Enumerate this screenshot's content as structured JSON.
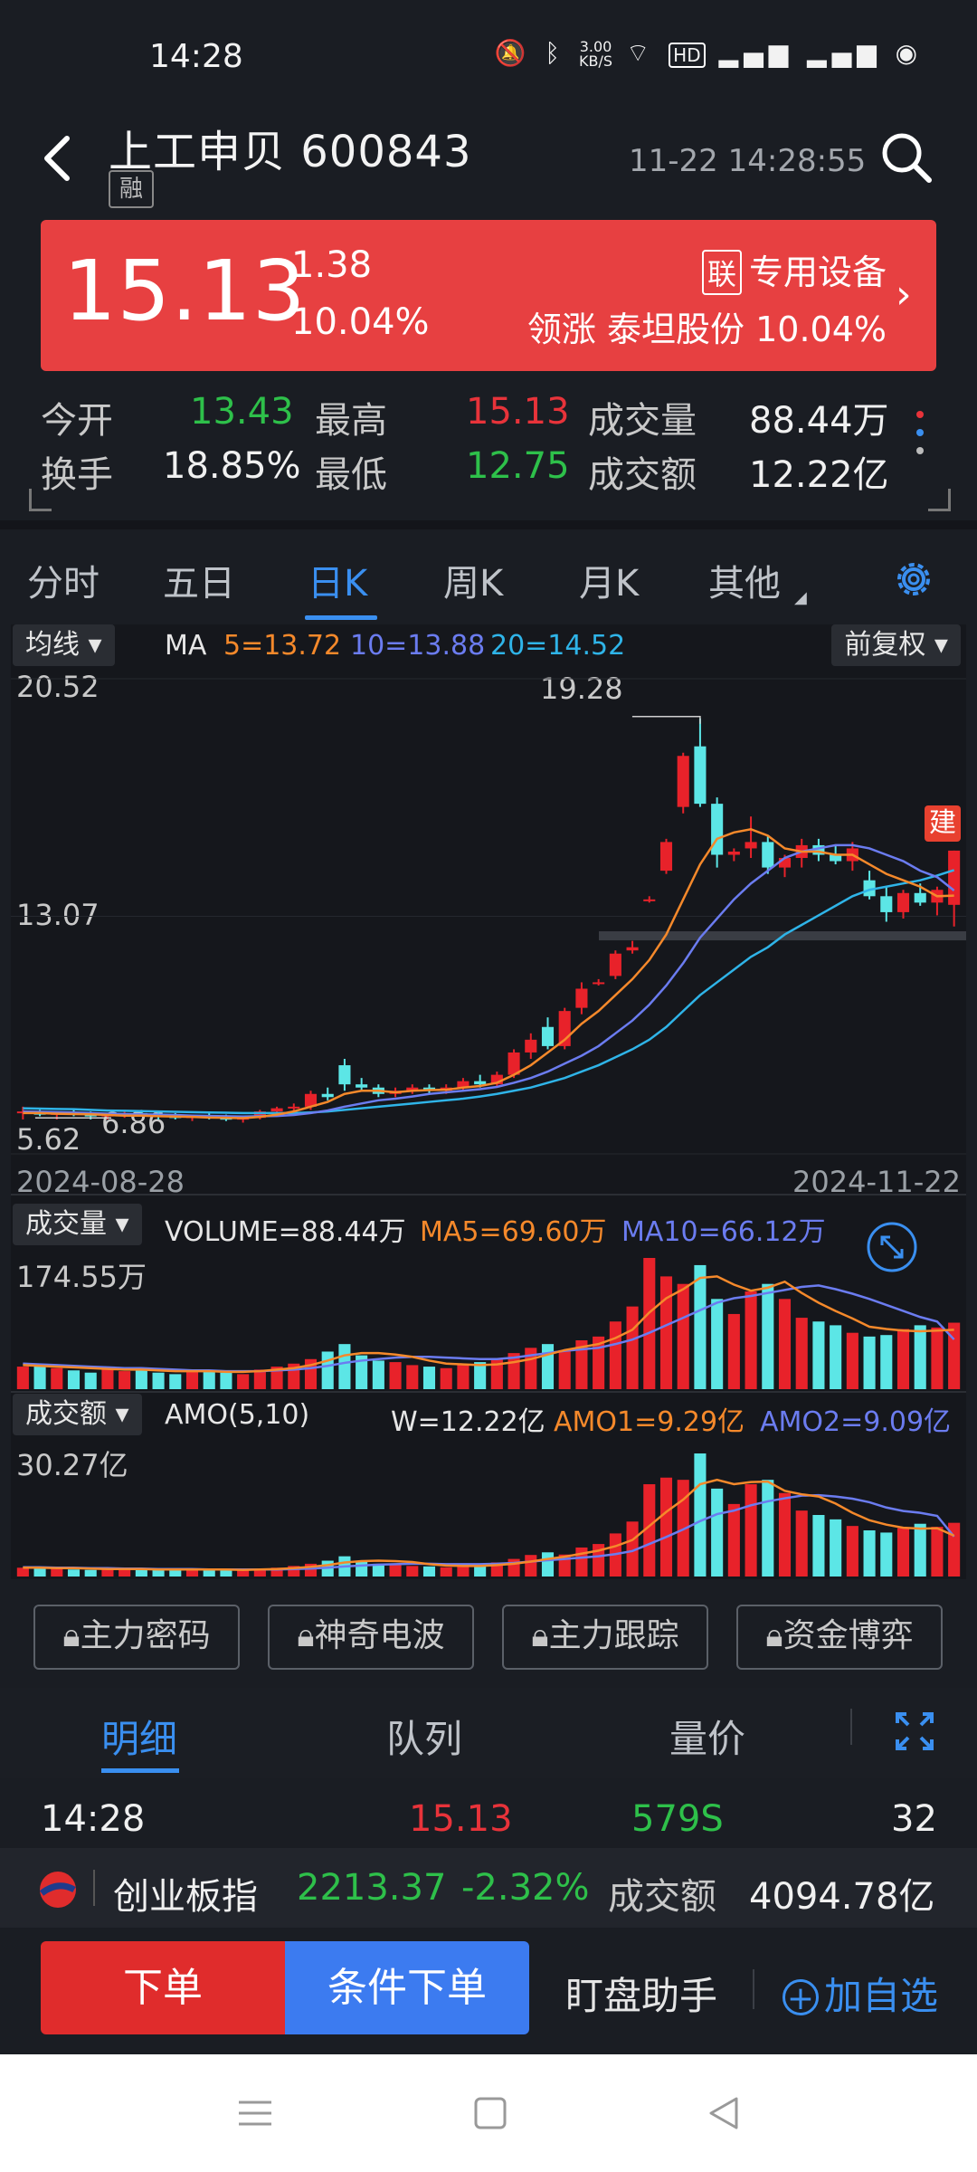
{
  "status": {
    "time": "14:28",
    "net_speed_top": "3.00",
    "net_speed_unit": "KB/S"
  },
  "header": {
    "back_icon": "chevron-left-icon",
    "title": "上工申贝 600843",
    "badge": "融",
    "datetime": "11-22 14:28:55"
  },
  "quote": {
    "price": "15.13",
    "change": "1.38",
    "change_pct": "10.04%",
    "sector_tag": "联",
    "sector": "专用设备",
    "leader_prefix": "领涨",
    "leader_name": "泰坦股份",
    "leader_pct": "10.04%"
  },
  "stats": {
    "open_label": "今开",
    "open": "13.43",
    "high_label": "最高",
    "high": "15.13",
    "volume_label": "成交量",
    "volume": "88.44万",
    "turnover_label": "换手",
    "turnover": "18.85%",
    "low_label": "最低",
    "low": "12.75",
    "amount_label": "成交额",
    "amount": "12.22亿"
  },
  "tabs": [
    "分时",
    "五日",
    "日K",
    "周K",
    "月K",
    "其他"
  ],
  "active_tab": "日K",
  "kline": {
    "indicator_pill": "均线",
    "ma_label": "MA",
    "ma5": "5=13.72",
    "ma10": "10=13.88",
    "ma20": "20=14.52",
    "adjust_pill": "前复权",
    "y_top": "20.52",
    "y_mid": "13.07",
    "y_bottom": "5.62",
    "high_mark": "19.28",
    "low_mark": "6.86",
    "date_start": "2024-08-28",
    "date_end": "2024-11-22",
    "jian": "建",
    "colors": {
      "ma5": "#f5892b",
      "ma10": "#6b7cf0",
      "ma20": "#2fb4e8",
      "up": "#e8222a",
      "down": "#5ce6e6"
    }
  },
  "volume": {
    "pill": "成交量",
    "label": "VOLUME=88.44万",
    "ma5": "MA5=69.60万",
    "ma10": "MA10=66.12万",
    "ymax": "174.55万"
  },
  "amount": {
    "pill": "成交额",
    "label": "AMO(5,10)",
    "label_w": "W=12.22亿",
    "amo1": "AMO1=9.29亿",
    "amo2": "AMO2=9.09亿",
    "ymax": "30.27亿"
  },
  "feature_buttons": [
    "主力密码",
    "神奇电波",
    "主力跟踪",
    "资金博弈"
  ],
  "detail_tabs": [
    "明细",
    "队列",
    "量价"
  ],
  "trade_row": {
    "time": "14:28",
    "price": "15.13",
    "vol": "579S",
    "count": "32"
  },
  "index_bar": {
    "name": "创业板指",
    "value": "2213.37",
    "pct": "-2.32%",
    "amount_label": "成交额",
    "amount": "4094.78亿"
  },
  "bottom": {
    "order": "下单",
    "cond_order": "条件下单",
    "assistant": "盯盘助手",
    "add_fav": "加自选"
  },
  "chart_data": {
    "type": "candlestick",
    "x": [
      "2024-08-28",
      "2024-11-22"
    ],
    "ylim": [
      5.62,
      20.52
    ],
    "annotations": {
      "max": 19.28,
      "min": 6.86
    },
    "ohlc": [
      [
        6.9,
        7.1,
        6.7,
        6.95
      ],
      [
        6.95,
        7.0,
        6.8,
        6.85
      ],
      [
        6.85,
        6.95,
        6.7,
        6.9
      ],
      [
        6.9,
        7.0,
        6.8,
        6.85
      ],
      [
        6.85,
        6.95,
        6.7,
        6.8
      ],
      [
        6.8,
        6.9,
        6.7,
        6.85
      ],
      [
        6.85,
        6.95,
        6.75,
        6.9
      ],
      [
        6.9,
        7.0,
        6.8,
        6.85
      ],
      [
        6.85,
        6.95,
        6.7,
        6.8
      ],
      [
        6.8,
        6.9,
        6.7,
        6.75
      ],
      [
        6.75,
        6.85,
        6.65,
        6.8
      ],
      [
        6.8,
        6.9,
        6.7,
        6.75
      ],
      [
        6.75,
        6.85,
        6.65,
        6.7
      ],
      [
        6.7,
        6.8,
        6.6,
        6.75
      ],
      [
        6.75,
        7.0,
        6.7,
        6.95
      ],
      [
        6.95,
        7.1,
        6.85,
        7.05
      ],
      [
        7.05,
        7.2,
        6.95,
        7.1
      ],
      [
        7.1,
        7.6,
        7.0,
        7.5
      ],
      [
        7.5,
        7.7,
        7.3,
        7.4
      ],
      [
        8.4,
        8.6,
        7.6,
        7.8
      ],
      [
        7.8,
        8.0,
        7.6,
        7.7
      ],
      [
        7.7,
        7.8,
        7.4,
        7.5
      ],
      [
        7.5,
        7.7,
        7.4,
        7.6
      ],
      [
        7.6,
        7.8,
        7.5,
        7.7
      ],
      [
        7.7,
        7.8,
        7.5,
        7.6
      ],
      [
        7.6,
        7.8,
        7.5,
        7.7
      ],
      [
        7.7,
        8.0,
        7.6,
        7.9
      ],
      [
        7.9,
        8.1,
        7.7,
        7.8
      ],
      [
        7.8,
        8.2,
        7.7,
        8.1
      ],
      [
        8.1,
        8.9,
        8.0,
        8.8
      ],
      [
        8.8,
        9.4,
        8.6,
        9.2
      ],
      [
        9.6,
        9.9,
        8.9,
        9.0
      ],
      [
        9.0,
        10.2,
        8.9,
        10.1
      ],
      [
        10.2,
        11.0,
        10.0,
        10.8
      ],
      [
        11.0,
        11.1,
        10.9,
        11.0
      ],
      [
        11.2,
        12.0,
        11.1,
        11.9
      ],
      [
        12.0,
        12.3,
        11.9,
        12.1
      ],
      [
        13.6,
        13.7,
        13.5,
        13.6
      ],
      [
        14.5,
        15.5,
        14.4,
        15.4
      ],
      [
        16.5,
        18.2,
        16.3,
        18.1
      ],
      [
        18.4,
        19.28,
        16.5,
        16.6
      ],
      [
        16.6,
        16.8,
        14.6,
        15.0
      ],
      [
        15.0,
        15.2,
        14.8,
        15.1
      ],
      [
        15.2,
        16.2,
        14.9,
        15.4
      ],
      [
        15.4,
        15.6,
        14.4,
        14.6
      ],
      [
        14.6,
        15.0,
        14.3,
        14.9
      ],
      [
        14.9,
        15.5,
        14.6,
        15.3
      ],
      [
        15.3,
        15.5,
        14.8,
        15.0
      ],
      [
        15.0,
        15.3,
        14.7,
        14.8
      ],
      [
        14.8,
        15.4,
        14.5,
        15.2
      ],
      [
        14.2,
        14.5,
        13.6,
        13.7
      ],
      [
        13.7,
        14.0,
        12.9,
        13.2
      ],
      [
        13.2,
        13.9,
        13.0,
        13.8
      ],
      [
        13.8,
        14.1,
        13.4,
        13.5
      ],
      [
        13.5,
        14.0,
        13.1,
        13.9
      ],
      [
        13.43,
        15.13,
        12.75,
        15.13
      ]
    ],
    "ma5": [
      6.9,
      6.9,
      6.88,
      6.87,
      6.86,
      6.84,
      6.82,
      6.82,
      6.8,
      6.79,
      6.78,
      6.76,
      6.75,
      6.74,
      6.78,
      6.85,
      6.95,
      7.1,
      7.25,
      7.5,
      7.6,
      7.6,
      7.55,
      7.6,
      7.62,
      7.63,
      7.7,
      7.75,
      7.85,
      8.1,
      8.4,
      8.8,
      9.2,
      9.7,
      10.1,
      10.6,
      11.1,
      11.7,
      12.5,
      13.6,
      14.7,
      15.5,
      15.7,
      15.8,
      15.6,
      15.2,
      15.1,
      15.1,
      15.0,
      15.0,
      14.7,
      14.4,
      14.2,
      14.0,
      13.7,
      13.72
    ],
    "ma10": [
      6.95,
      6.94,
      6.93,
      6.92,
      6.9,
      6.88,
      6.87,
      6.86,
      6.85,
      6.84,
      6.82,
      6.81,
      6.8,
      6.79,
      6.8,
      6.81,
      6.84,
      6.9,
      6.98,
      7.1,
      7.2,
      7.3,
      7.35,
      7.42,
      7.5,
      7.55,
      7.6,
      7.65,
      7.72,
      7.85,
      8.0,
      8.2,
      8.45,
      8.7,
      9.0,
      9.4,
      9.8,
      10.3,
      10.9,
      11.6,
      12.4,
      13.0,
      13.6,
      14.1,
      14.5,
      14.9,
      15.1,
      15.2,
      15.3,
      15.3,
      15.2,
      15.0,
      14.8,
      14.5,
      14.3,
      13.88
    ],
    "ma20": [
      7.05,
      7.04,
      7.03,
      7.02,
      7.0,
      6.98,
      6.97,
      6.96,
      6.95,
      6.94,
      6.93,
      6.92,
      6.91,
      6.9,
      6.9,
      6.9,
      6.9,
      6.92,
      6.95,
      7.0,
      7.05,
      7.1,
      7.15,
      7.2,
      7.25,
      7.3,
      7.35,
      7.42,
      7.5,
      7.6,
      7.7,
      7.85,
      8.0,
      8.2,
      8.4,
      8.65,
      8.9,
      9.2,
      9.6,
      10.1,
      10.6,
      11.0,
      11.4,
      11.8,
      12.1,
      12.5,
      12.8,
      13.1,
      13.4,
      13.7,
      13.9,
      14.0,
      14.1,
      14.2,
      14.35,
      14.52
    ],
    "volume_ymax": 174.55,
    "volume": [
      30,
      32,
      28,
      25,
      22,
      28,
      24,
      26,
      22,
      20,
      25,
      24,
      22,
      20,
      26,
      30,
      34,
      40,
      50,
      60,
      45,
      38,
      36,
      32,
      30,
      28,
      32,
      36,
      40,
      48,
      55,
      60,
      52,
      65,
      70,
      90,
      110,
      174.55,
      150,
      140,
      165,
      120,
      100,
      130,
      140,
      120,
      95,
      90,
      85,
      75,
      70,
      72,
      80,
      85,
      82,
      88.44
    ],
    "volume_ma5": [
      32,
      31,
      30,
      29,
      28,
      27,
      26,
      26,
      25,
      24,
      24,
      24,
      23,
      23,
      24,
      26,
      28,
      32,
      38,
      45,
      48,
      48,
      46,
      43,
      38,
      34,
      33,
      32,
      33,
      36,
      40,
      46,
      52,
      56,
      60,
      68,
      79,
      102,
      121,
      133,
      148,
      150,
      139,
      131,
      135,
      143,
      128,
      115,
      104,
      94,
      83,
      80,
      78,
      77,
      78,
      79
    ],
    "volume_ma10": [
      34,
      33,
      32,
      31,
      30,
      29,
      28,
      28,
      27,
      26,
      25,
      25,
      24,
      24,
      24,
      25,
      26,
      28,
      31,
      35,
      38,
      40,
      42,
      43,
      43,
      42,
      41,
      40,
      40,
      42,
      45,
      48,
      51,
      53,
      55,
      60,
      66,
      75,
      85,
      95,
      105,
      115,
      121,
      124,
      128,
      132,
      136,
      138,
      133,
      127,
      120,
      112,
      104,
      96,
      90,
      66.12
    ],
    "amount_ymax": 30.27,
    "amount": [
      2.0,
      2.1,
      1.8,
      1.6,
      1.5,
      1.9,
      1.6,
      1.7,
      1.5,
      1.4,
      1.7,
      1.6,
      1.5,
      1.4,
      1.8,
      2.0,
      2.4,
      2.9,
      3.6,
      4.6,
      3.5,
      2.9,
      2.8,
      2.4,
      2.3,
      2.1,
      2.5,
      2.8,
      3.2,
      4.0,
      4.9,
      5.5,
      5.0,
      6.6,
      7.4,
      9.8,
      12.5,
      21.0,
      22.5,
      22.0,
      28.0,
      20.0,
      16.5,
      21.0,
      22.0,
      19.0,
      15.0,
      14.0,
      13.0,
      11.5,
      10.5,
      10.0,
      11.0,
      12.0,
      11.3,
      12.22
    ],
    "amount_ma5": [
      2.0,
      2.0,
      1.9,
      1.9,
      1.8,
      1.7,
      1.7,
      1.7,
      1.6,
      1.6,
      1.6,
      1.6,
      1.6,
      1.5,
      1.6,
      1.7,
      1.9,
      2.2,
      2.6,
      3.2,
      3.5,
      3.6,
      3.5,
      3.3,
      2.8,
      2.5,
      2.4,
      2.4,
      2.6,
      2.9,
      3.4,
      4.0,
      4.5,
      5.2,
      5.9,
      6.9,
      8.3,
      11.5,
      14.7,
      17.5,
      21.0,
      22.0,
      21.0,
      21.5,
      21.6,
      19.5,
      18.7,
      18.2,
      16.6,
      14.5,
      12.8,
      11.8,
      11.1,
      10.9,
      11.0,
      9.29
    ],
    "amount_ma10": [
      2.1,
      2.1,
      2.0,
      2.0,
      1.9,
      1.9,
      1.8,
      1.8,
      1.7,
      1.7,
      1.7,
      1.6,
      1.6,
      1.6,
      1.6,
      1.6,
      1.7,
      1.8,
      2.0,
      2.3,
      2.5,
      2.7,
      2.8,
      2.9,
      2.9,
      2.8,
      2.8,
      2.8,
      2.9,
      3.1,
      3.4,
      3.7,
      4.0,
      4.3,
      4.6,
      5.1,
      5.8,
      7.4,
      9.0,
      10.7,
      12.6,
      14.2,
      15.0,
      16.2,
      17.1,
      17.8,
      18.4,
      18.5,
      18.2,
      17.7,
      16.9,
      15.7,
      14.9,
      14.5,
      13.8,
      9.09
    ]
  }
}
